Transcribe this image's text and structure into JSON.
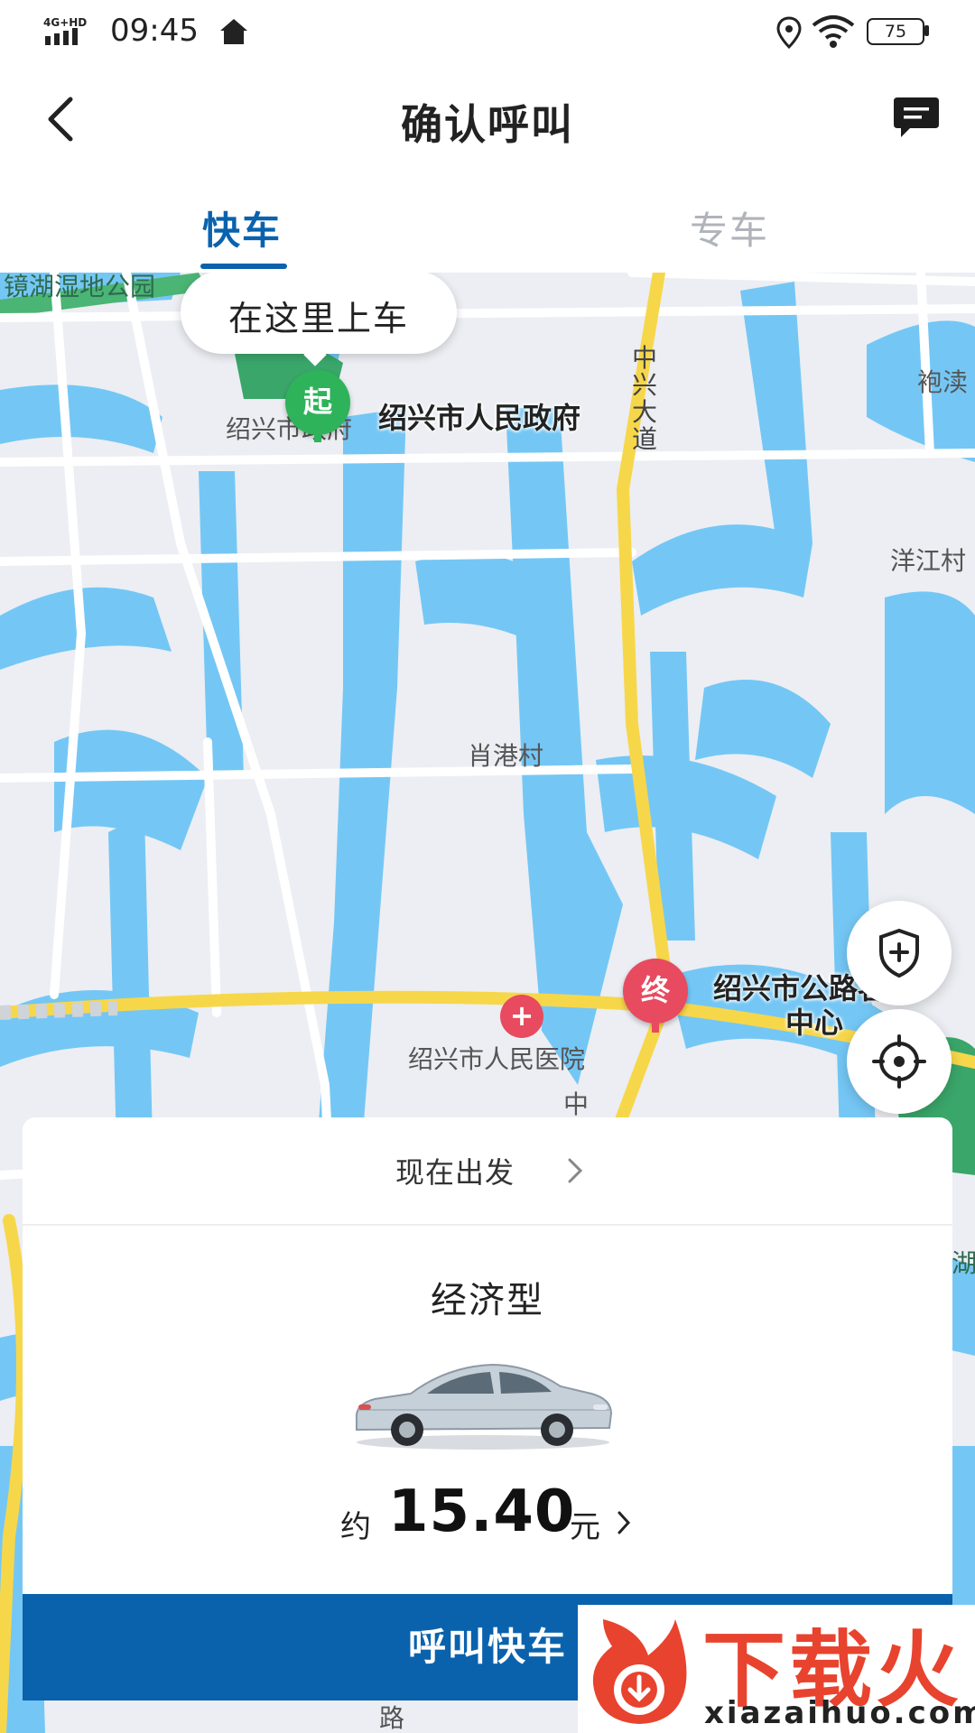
{
  "status_bar": {
    "network": "4G+HD",
    "time": "09:45",
    "battery": "75"
  },
  "header": {
    "title": "确认呼叫"
  },
  "tabs": [
    {
      "label": "快车",
      "active": true
    },
    {
      "label": "专车",
      "active": false
    }
  ],
  "map": {
    "pickup_bubble": "在这里上车",
    "start_pin": "起",
    "end_pin": "终",
    "start_poi": "绍兴市人民政府",
    "end_poi": "绍兴市公路客运中心",
    "labels": {
      "gov": "绍兴市政府",
      "road1": "中兴大道",
      "road2": "中",
      "village": "肖港村",
      "hospital": "绍兴市人民医院",
      "pao": "袍渎",
      "yang": "洋江村",
      "park": "镜湖湿地公园",
      "lu": "路",
      "hu": "湖"
    }
  },
  "sheet": {
    "depart_label": "现在出发",
    "vehicle_type": "经济型",
    "price_prefix": "约",
    "price": "15.40",
    "price_unit": "元",
    "call_button": "呼叫快车"
  },
  "watermark": {
    "brand": "下载火",
    "url": "xiazaihuo.com"
  },
  "colors": {
    "accent": "#0a62ad",
    "water": "#74c7f5",
    "road_major": "#f7d74a",
    "start_green": "#2eb35a",
    "end_red": "#e84a5f",
    "watermark_red": "#e8432e"
  }
}
